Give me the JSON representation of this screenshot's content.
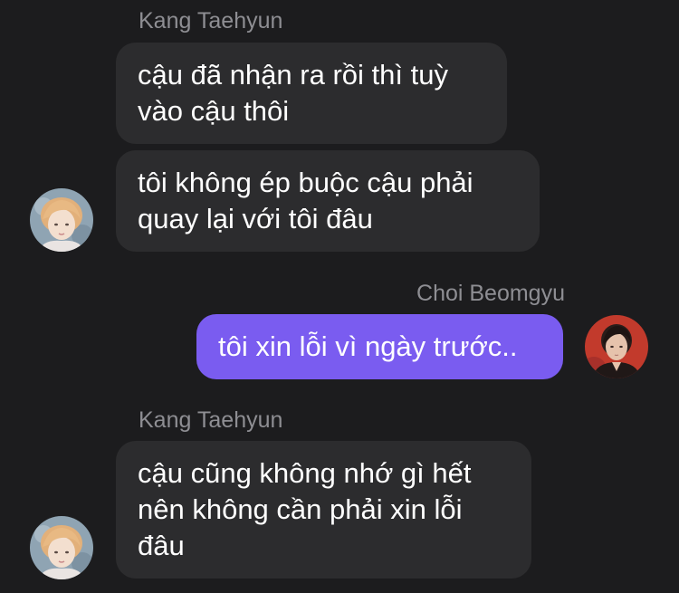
{
  "conversation": {
    "groups": [
      {
        "sender": "Kang Taehyun",
        "messages": [
          "cậu đã nhận ra rồi thì tuỳ\nvào cậu thôi",
          "tôi không ép buộc cậu phải\nquay lại với tôi đâu"
        ]
      },
      {
        "sender": "Choi Beomgyu",
        "messages": [
          "tôi xin lỗi vì ngày trước.."
        ]
      },
      {
        "sender": "Kang Taehyun",
        "messages": [
          "cậu cũng không nhớ gì hết\nnên không cần phải xin lỗi\nđâu"
        ]
      }
    ]
  },
  "colors": {
    "background": "#1c1c1e",
    "incoming_bubble": "#2c2c2e",
    "outgoing_bubble": "#7a5cf0",
    "sender_name": "#8e8e93",
    "message_text": "#ffffff"
  },
  "icons": {
    "taehyun_avatar": "avatar-blonde-person",
    "beomgyu_avatar": "avatar-dark-hair-person"
  }
}
